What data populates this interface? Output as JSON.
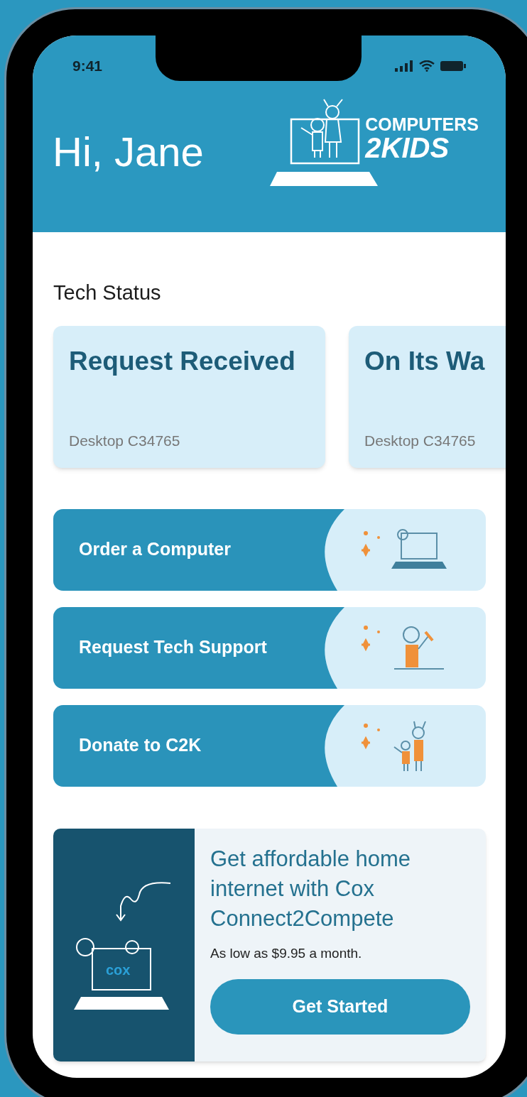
{
  "status_bar": {
    "time": "9:41"
  },
  "header": {
    "greeting": "Hi, Jane",
    "logo_lines": [
      "COMPUTERS",
      "2KIDS"
    ]
  },
  "tech_status": {
    "title": "Tech Status",
    "cards": [
      {
        "title": "Request Received",
        "device": "Desktop C34765"
      },
      {
        "title": "On Its Wa",
        "device": "Desktop C34765"
      }
    ]
  },
  "actions": [
    {
      "label": "Order a Computer",
      "kind": "laptop"
    },
    {
      "label": "Request Tech Support",
      "kind": "support"
    },
    {
      "label": "Donate to C2K",
      "kind": "kids"
    }
  ],
  "promo": {
    "headline": "Get affordable home internet with Cox Connect2Compete",
    "subtitle": "As low as $9.95 a month.",
    "button": "Get Started",
    "screen_text": "cox"
  }
}
